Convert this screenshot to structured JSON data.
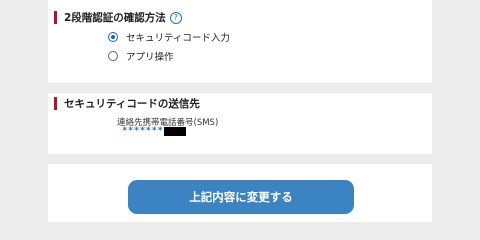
{
  "verification_method": {
    "title": "2段階認証の確認方法",
    "help_icon": "question-circle-icon",
    "options": [
      {
        "label": "セキュリティコード入力",
        "selected": true
      },
      {
        "label": "アプリ操作",
        "selected": false
      }
    ]
  },
  "code_delivery": {
    "title": "セキュリティコードの送信先",
    "destination_label": "連絡先携帯電話番号(SMS)",
    "masked_number": "*******"
  },
  "submit": {
    "label": "上記内容に変更する"
  },
  "colors": {
    "accent_bar": "#a8192e",
    "button": "#3b83c1",
    "link_blue": "#2a70b8",
    "background": "#ececec"
  }
}
